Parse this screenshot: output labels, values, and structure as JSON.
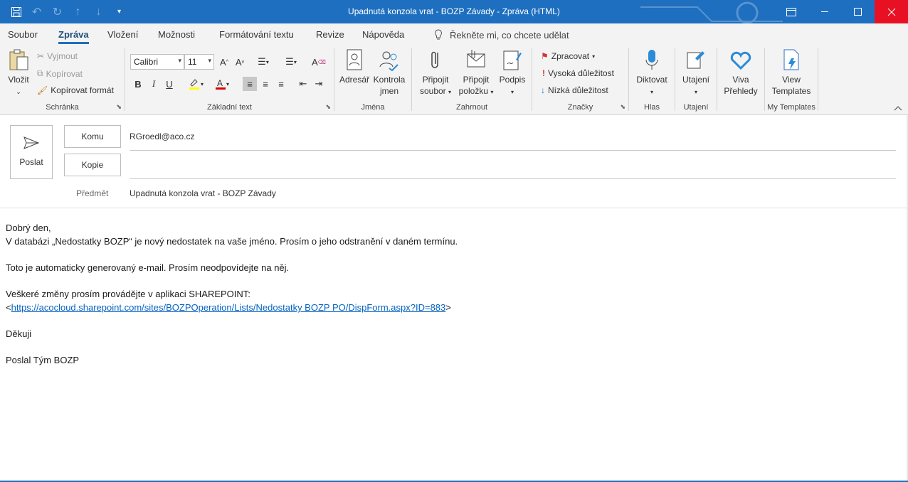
{
  "window": {
    "title": "Upadnutá konzola vrat  -  BOZP Závady  -  Zpráva (HTML)",
    "accent": "#1e6fbf",
    "close_color": "#e81123"
  },
  "tabs": [
    "Soubor",
    "Zpráva",
    "Vložení",
    "Možnosti",
    "Formátování textu",
    "Revize",
    "Nápověda"
  ],
  "active_tab": "Zpráva",
  "tell_me": "Řekněte mi, co chcete udělat",
  "ribbon": {
    "clipboard": {
      "label": "Schránka",
      "paste": "Vložit",
      "cut": "Vyjmout",
      "copy": "Kopírovat",
      "format_painter": "Kopírovat formát"
    },
    "basic_text": {
      "label": "Základní text",
      "font": "Calibri",
      "size": "11"
    },
    "names": {
      "label": "Jména",
      "address_book": "Adresář",
      "check_names_1": "Kontrola",
      "check_names_2": "jmen"
    },
    "include": {
      "label": "Zahrnout",
      "attach_file_1": "Připojit",
      "attach_file_2": "soubor",
      "attach_item_1": "Připojit",
      "attach_item_2": "položku",
      "signature": "Podpis"
    },
    "tags": {
      "label": "Značky",
      "follow_up": "Zpracovat",
      "high_importance": "Vysoká důležitost",
      "low_importance": "Nízká důležitost"
    },
    "voice": {
      "label": "Hlas",
      "dictate": "Diktovat"
    },
    "sensitivity": {
      "label": "Utajení",
      "sensitivity": "Utajení"
    },
    "viva": {
      "label_1": "Viva",
      "label_2": "Přehledy"
    },
    "templates": {
      "label": "My Templates",
      "view_1": "View",
      "view_2": "Templates"
    }
  },
  "header": {
    "send": "Poslat",
    "to_label": "Komu",
    "to_value": "RGroedl@aco.cz",
    "cc_label": "Kopie",
    "cc_value": "",
    "subject_label": "Předmět",
    "subject_value": "Upadnutá konzola vrat - BOZP Závady"
  },
  "body": {
    "greeting": "Dobrý den,",
    "line1": "V databázi „Nedostatky BOZP“ je nový nedostatek na vaše jméno. Prosím o jeho odstranění v daném termínu.",
    "line2": "Toto je automaticky generovaný e-mail. Prosím neodpovídejte na něj.",
    "line3": "Veškeré změny prosím provádějte v aplikaci SHAREPOINT:",
    "link_open": "<",
    "link": "https://acocloud.sharepoint.com/sites/BOZPOperation/Lists/Nedostatky BOZP PO/DispForm.aspx?ID=883",
    "link_close": ">",
    "thanks": "Děkuji",
    "signature": "Poslal Tým BOZP"
  }
}
